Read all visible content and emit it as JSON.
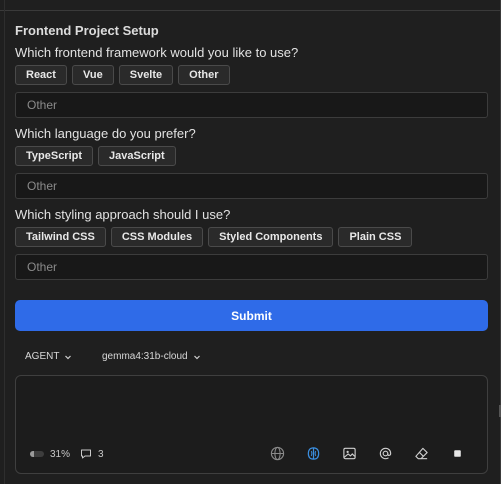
{
  "form": {
    "title": "Frontend Project Setup",
    "questions": [
      {
        "label": "Which frontend framework would you like to use?",
        "options": [
          "React",
          "Vue",
          "Svelte",
          "Other"
        ],
        "other_placeholder": "Other"
      },
      {
        "label": "Which language do you prefer?",
        "options": [
          "TypeScript",
          "JavaScript"
        ],
        "other_placeholder": "Other"
      },
      {
        "label": "Which styling approach should I use?",
        "options": [
          "Tailwind CSS",
          "CSS Modules",
          "Styled Components",
          "Plain CSS"
        ],
        "other_placeholder": "Other"
      }
    ],
    "submit_label": "Submit"
  },
  "toolbar": {
    "mode_label": "AGENT",
    "model_label": "gemma4:31b-cloud"
  },
  "composer": {
    "context_percent": "31%",
    "context_fraction": 0.31,
    "comments_count": "3",
    "icons": [
      "globe-icon",
      "brain-icon",
      "image-icon",
      "at-icon",
      "eraser-icon",
      "stop-icon"
    ]
  },
  "colors": {
    "accent": "#2f6be8",
    "active_tool": "#3b8fe0",
    "background": "#1f1f1f"
  }
}
